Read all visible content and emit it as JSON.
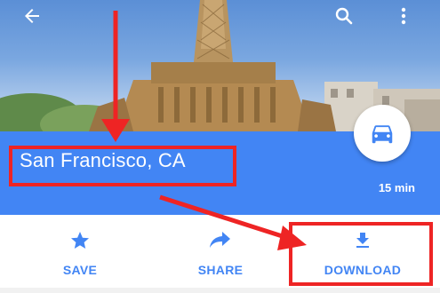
{
  "header": {
    "back_icon": "arrow-left-icon",
    "search_icon": "search-icon",
    "more_icon": "more-vert-icon"
  },
  "place": {
    "title": "San Francisco, CA",
    "travel_time": "15 min",
    "directions_icon": "car-icon"
  },
  "actions": [
    {
      "label": "SAVE",
      "icon": "star-icon"
    },
    {
      "label": "SHARE",
      "icon": "share-arrow-icon"
    },
    {
      "label": "DOWNLOAD",
      "icon": "download-icon"
    }
  ],
  "colors": {
    "accent_blue": "#4285f4",
    "annotation_red": "#ee2424",
    "white": "#ffffff"
  }
}
